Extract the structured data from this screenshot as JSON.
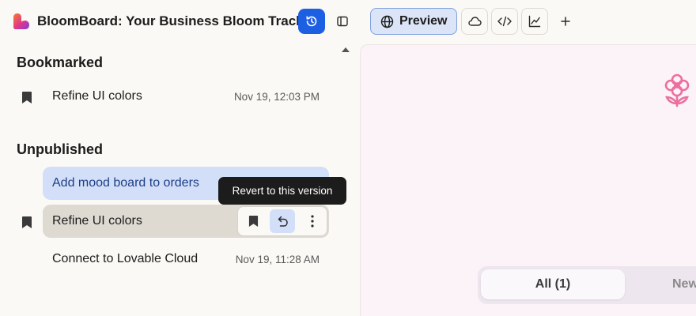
{
  "app": {
    "title": "BloomBoard: Your Business Bloom Tracker",
    "brand_colors": [
      "#f57a2d",
      "#e0368c",
      "#7e3fd6"
    ]
  },
  "toolbar": {
    "preview_label": "Preview",
    "accent": "#1d5fe3",
    "buttons": [
      "history-icon",
      "sidebar-toggle-icon",
      "globe-icon",
      "cloud-icon",
      "code-icon",
      "analytics-icon",
      "plus-icon"
    ]
  },
  "history": {
    "bookmarked": {
      "title": "Bookmarked",
      "items": [
        {
          "label": "Refine UI colors",
          "date": "Nov 19, 12:03 PM"
        }
      ]
    },
    "unpublished": {
      "title": "Unpublished",
      "items": [
        {
          "label": "Add mood board to orders",
          "state": "selected"
        },
        {
          "label": "Refine UI colors",
          "state": "hover"
        },
        {
          "label": "Connect to Lovable Cloud",
          "date": "Nov 19, 11:28 AM"
        }
      ]
    },
    "tooltip": "Revert to this version"
  },
  "preview": {
    "filters": [
      {
        "label": "All (1)",
        "active": true
      },
      {
        "label": "New"
      }
    ],
    "icon": "flower-icon"
  }
}
